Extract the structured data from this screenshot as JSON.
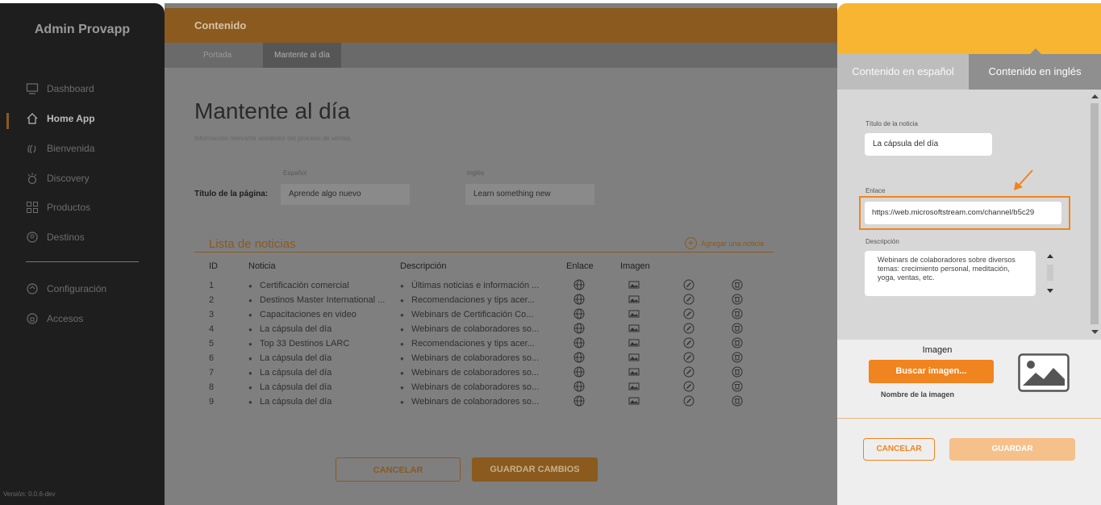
{
  "sidebar": {
    "brand": "Admin Provapp",
    "items": [
      {
        "label": "Dashboard",
        "icon": "monitor-icon"
      },
      {
        "label": "Home App",
        "icon": "home-icon",
        "active": true
      },
      {
        "label": "Bienvenida",
        "icon": "wave-hand-icon"
      },
      {
        "label": "Discovery",
        "icon": "sparkle-icon"
      },
      {
        "label": "Productos",
        "icon": "grid-icon"
      },
      {
        "label": "Destinos",
        "icon": "location-pin-icon"
      }
    ],
    "bottom_items": [
      {
        "label": "Configuración",
        "icon": "settings-icon"
      },
      {
        "label": "Accesos",
        "icon": "lock-icon"
      }
    ],
    "version": "Versión: 0.0.6-dev"
  },
  "main": {
    "section_title": "Contenido",
    "tabs": [
      "Portada",
      "Mantente al día"
    ],
    "page_title": "Mantente al día",
    "page_subtitle": "Información relevante alrededor del proceso de ventas.",
    "title_field": {
      "label": "Título de la página:",
      "es_label": "Español",
      "en_label": "Inglés",
      "es_value": "Aprende algo nuevo",
      "en_value": "Learn something new"
    },
    "list": {
      "title": "Lista de noticias",
      "add_label": "Agregar una noticia",
      "columns": [
        "ID",
        "Noticia",
        "Descripción",
        "Enlace",
        "Imagen"
      ],
      "rows": [
        {
          "id": "1",
          "noticia": "Certificación comercial",
          "descripcion": "Últimas noticias e información ..."
        },
        {
          "id": "2",
          "noticia": "Destinos Master International ...",
          "descripcion": "Recomendaciones y tips acer..."
        },
        {
          "id": "3",
          "noticia": "Capacitaciones en video",
          "descripcion": "Webinars de Certificación Co..."
        },
        {
          "id": "4",
          "noticia": "La cápsula del día",
          "descripcion": "Webinars de colaboradores so..."
        },
        {
          "id": "5",
          "noticia": "Top 33 Destinos LARC",
          "descripcion": "Recomendaciones y tips acer..."
        },
        {
          "id": "6",
          "noticia": "La cápsula del día",
          "descripcion": "Webinars de colaboradores so..."
        },
        {
          "id": "7",
          "noticia": "La cápsula del día",
          "descripcion": "Webinars de colaboradores so..."
        },
        {
          "id": "8",
          "noticia": "La cápsula del día",
          "descripcion": "Webinars de colaboradores so..."
        },
        {
          "id": "9",
          "noticia": "La cápsula del día",
          "descripcion": "Webinars de colaboradores so..."
        }
      ]
    },
    "buttons": {
      "cancel": "CANCELAR",
      "save": "GUARDAR CAMBIOS"
    }
  },
  "panel": {
    "tabs": {
      "es": "Contenido en español",
      "en": "Contenido en inglés"
    },
    "title_label": "Título de la noticia",
    "title_value": "La cápsula del día",
    "link_label": "Enlace",
    "link_value": "https://web.microsoftstream.com/channel/b5c29",
    "desc_label": "Descripción",
    "desc_value": "Webinars de colaboradores sobre diversos temas: crecimiento personal, meditación, yoga, ventas, etc.",
    "image_title": "Imagen",
    "search_image": "Buscar imagen...",
    "image_name_label": "Nombre de la imagen",
    "cancel": "CANCELAR",
    "save": "GUARDAR"
  },
  "colors": {
    "accent": "#f0841e",
    "header_yellow": "#f7b531",
    "sidebar_bg": "#1e1e1e"
  }
}
